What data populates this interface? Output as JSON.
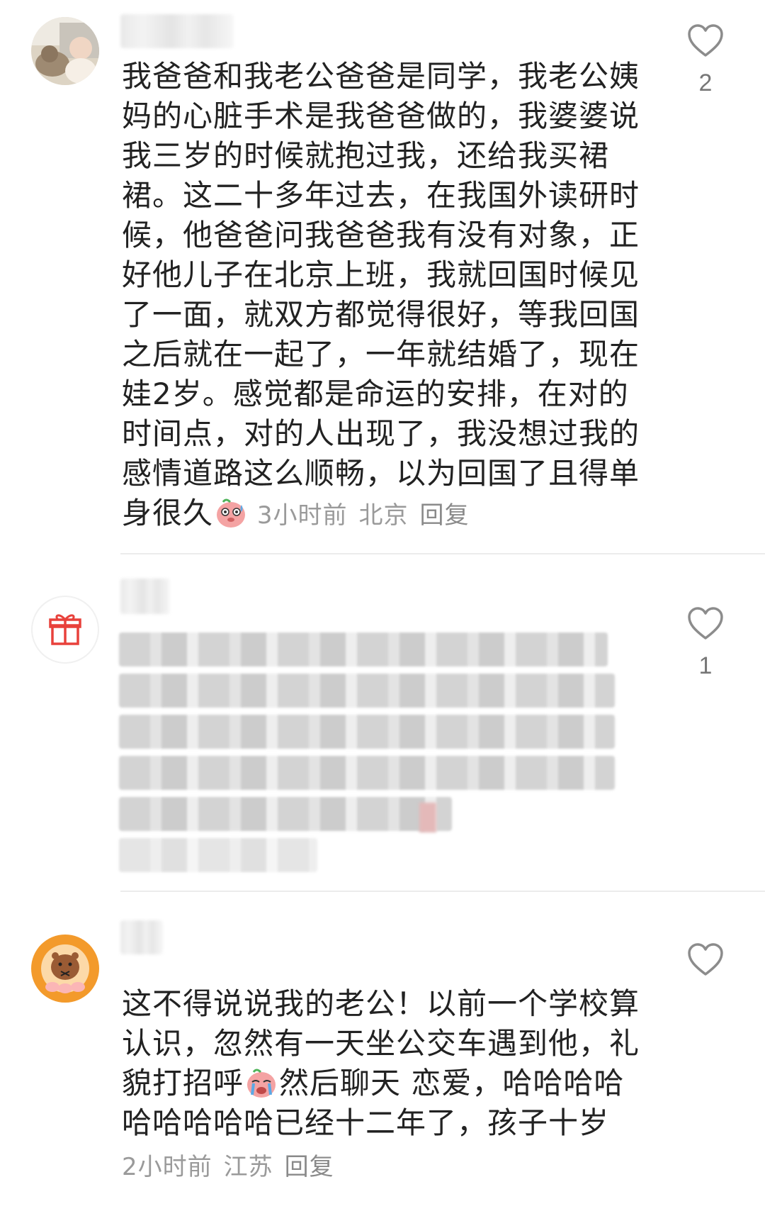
{
  "comments": [
    {
      "text_before_emoji": "我爸爸和我老公爸爸是同学，我老公姨妈的心脏手术是我爸爸做的，我婆婆说我三岁的时候就抱过我，还给我买裙裙。这二十多年过去，在我国外读研时候，他爸爸问我爸爸我有没有对象，正好他儿子在北京上班，我就回国时候见了一面，就双方都觉得很好，等我回国之后就在一起了，一年就结婚了，现在娃2岁。感觉都是命运的安排，在对的时间点，对的人出现了，我没想过我的感情道路这么顺畅，以为回国了且得单身很久",
      "emoji_icon": "sweat-face-emoji",
      "time": "3小时前",
      "location": "北京",
      "reply_label": "回复",
      "likes": "2"
    },
    {
      "avatar_icon": "gift-icon",
      "likes": "1"
    },
    {
      "text_before_emoji": "这不得说说我的老公！以前一个学校算认识，忽然有一天坐公交车遇到他，礼貌打招呼",
      "emoji_icon": "crying-face-emoji",
      "text_after_emoji": "然后聊天 恋爱，哈哈哈哈哈哈哈哈哈已经十二年了，孩子十岁",
      "time": "2小时前",
      "location": "江苏",
      "reply_label": "回复",
      "likes": ""
    }
  ],
  "colors": {
    "text": "#222222",
    "meta": "#9a9a9a",
    "divider": "#ececec",
    "heart_outline": "#8c8c8c"
  }
}
